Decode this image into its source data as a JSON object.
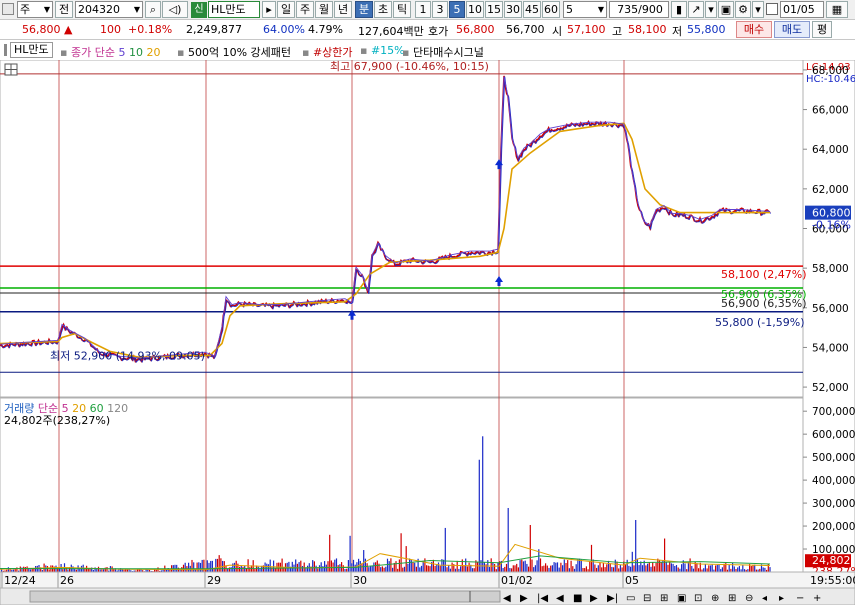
{
  "toolbar": {
    "mode": "주",
    "prev_label": "전",
    "code": "204320",
    "badge": "신",
    "name": "HL만도",
    "periods": [
      "일",
      "주",
      "월",
      "년"
    ],
    "units": [
      "분",
      "초",
      "틱"
    ],
    "intervals": [
      "1",
      "3",
      "5",
      "10",
      "15",
      "30",
      "45",
      "60"
    ],
    "selected_unit": "분",
    "selected_interval": "5",
    "interval_value": "5",
    "count": "735/900",
    "date": "01/05"
  },
  "quote": {
    "price": "56,800",
    "change": "100",
    "change_pct": "+0.18%",
    "volume": "2,249,877",
    "pct1": "64.00%",
    "pct2": "4.79%",
    "amount": "127,604백만",
    "bid_label": "호가",
    "bid": "56,800",
    "ask": "56,700",
    "open_label": "시",
    "open": "57,100",
    "high_label": "고",
    "high": "58,100",
    "low_label": "저",
    "low": "55,800",
    "buy_label": "매수",
    "sell_label": "매도",
    "eval_label": "평"
  },
  "legend": {
    "name": "HL만도",
    "ma_label": "종가 단순",
    "ma_periods": [
      "5",
      "10",
      "20"
    ],
    "pattern_label": "500억 10% 강세패턴",
    "limit_label": "#상한가",
    "pct_label": "#15%",
    "signal_label": "단타매수시그널"
  },
  "annotations": {
    "high": "최고 67,900 (-10.46%, 10:15)",
    "low": "최저 52,900 (14.93%, 09:05)",
    "lc": "LC:14.93",
    "hc": "HC:-10.46",
    "level1": "58,100 (2,47%)",
    "level2": "56,900 (6,35%)",
    "level3": "56,900 (6,35%)",
    "level4": "55,800 (-1,59%)",
    "current_price": "60,800",
    "current_pct": "-0.16%"
  },
  "volume_panel": {
    "label": "거래량",
    "ma_label": "단순",
    "ma_periods": [
      "5",
      "20",
      "60",
      "120"
    ],
    "current": "24,802주(238,27%)",
    "current_value": "24,802",
    "current_pct": "238,27%"
  },
  "bottom": {
    "time": "19:55:00"
  },
  "colors": {
    "up": "#d00000",
    "down": "#1a2ac8",
    "ma5": "#6040d0",
    "ma20": "#e0a000",
    "level_red": "#e00000",
    "level_green": "#00b000",
    "level_navy": "#0a1a80",
    "vline": "#c04040"
  },
  "chart_data": {
    "type": "line",
    "price_axis": {
      "ticks": [
        52000,
        54000,
        56000,
        58000,
        60000,
        62000,
        64000,
        66000,
        68000
      ],
      "labels": [
        "52,000",
        "54,000",
        "56,000",
        "58,000",
        "60,000",
        "62,000",
        "64,000",
        "66,000",
        "68,000"
      ],
      "range": [
        51500,
        68500
      ]
    },
    "volume_axis": {
      "ticks": [
        100000,
        200000,
        300000,
        400000,
        500000,
        600000,
        700000
      ],
      "labels": [
        "100,000",
        "200,000",
        "300,000",
        "400,000",
        "500,000",
        "600,000",
        "700,000"
      ],
      "range": [
        0,
        740000
      ]
    },
    "date_labels": [
      "12/24",
      "26",
      "29",
      "30",
      "01/02",
      "05"
    ],
    "price_series": [
      [
        0,
        54100
      ],
      [
        25,
        54200
      ],
      [
        58,
        54300
      ],
      [
        62,
        55100
      ],
      [
        70,
        54800
      ],
      [
        85,
        54400
      ],
      [
        100,
        53700
      ],
      [
        120,
        53500
      ],
      [
        140,
        53400
      ],
      [
        160,
        53500
      ],
      [
        180,
        53600
      ],
      [
        205,
        53700
      ],
      [
        215,
        53500
      ],
      [
        222,
        55000
      ],
      [
        226,
        56500
      ],
      [
        232,
        56100
      ],
      [
        240,
        56200
      ],
      [
        260,
        56100
      ],
      [
        280,
        56100
      ],
      [
        300,
        56200
      ],
      [
        320,
        56300
      ],
      [
        345,
        56400
      ],
      [
        352,
        56200
      ],
      [
        356,
        58000
      ],
      [
        362,
        57600
      ],
      [
        368,
        56800
      ],
      [
        372,
        58600
      ],
      [
        378,
        59200
      ],
      [
        385,
        58600
      ],
      [
        395,
        58200
      ],
      [
        410,
        58400
      ],
      [
        430,
        58300
      ],
      [
        450,
        58600
      ],
      [
        470,
        58800
      ],
      [
        490,
        58800
      ],
      [
        498,
        58900
      ],
      [
        501,
        64000
      ],
      [
        504,
        67600
      ],
      [
        508,
        66600
      ],
      [
        512,
        64500
      ],
      [
        518,
        63500
      ],
      [
        524,
        64000
      ],
      [
        532,
        64300
      ],
      [
        540,
        64700
      ],
      [
        550,
        65000
      ],
      [
        570,
        65200
      ],
      [
        590,
        65300
      ],
      [
        610,
        65300
      ],
      [
        624,
        65200
      ],
      [
        628,
        64200
      ],
      [
        632,
        62800
      ],
      [
        638,
        61200
      ],
      [
        644,
        60300
      ],
      [
        650,
        60100
      ],
      [
        656,
        60900
      ],
      [
        664,
        61100
      ],
      [
        672,
        60700
      ],
      [
        680,
        60700
      ],
      [
        690,
        60600
      ],
      [
        700,
        60400
      ],
      [
        712,
        60600
      ],
      [
        720,
        60900
      ],
      [
        740,
        60900
      ],
      [
        770,
        60800
      ]
    ],
    "ma20_series": [
      [
        0,
        54200
      ],
      [
        58,
        54300
      ],
      [
        62,
        54500
      ],
      [
        75,
        54700
      ],
      [
        90,
        54300
      ],
      [
        110,
        53800
      ],
      [
        140,
        53500
      ],
      [
        180,
        53600
      ],
      [
        210,
        53600
      ],
      [
        222,
        54200
      ],
      [
        230,
        55600
      ],
      [
        240,
        56100
      ],
      [
        280,
        56200
      ],
      [
        345,
        56300
      ],
      [
        356,
        56700
      ],
      [
        370,
        57700
      ],
      [
        390,
        58300
      ],
      [
        430,
        58400
      ],
      [
        480,
        58600
      ],
      [
        498,
        58800
      ],
      [
        504,
        60000
      ],
      [
        512,
        63000
      ],
      [
        530,
        63800
      ],
      [
        560,
        64900
      ],
      [
        600,
        65200
      ],
      [
        624,
        65300
      ],
      [
        632,
        64500
      ],
      [
        645,
        62000
      ],
      [
        660,
        61200
      ],
      [
        680,
        60800
      ],
      [
        720,
        60800
      ],
      [
        770,
        60800
      ]
    ],
    "volume_series": [
      [
        0,
        12000
      ],
      [
        60,
        30000
      ],
      [
        150,
        8000
      ],
      [
        225,
        70000
      ],
      [
        356,
        260000
      ],
      [
        372,
        130000
      ],
      [
        501,
        650000
      ],
      [
        512,
        250000
      ],
      [
        630,
        210000
      ],
      [
        700,
        30000
      ],
      [
        770,
        24802
      ]
    ],
    "levels": [
      58100,
      57000,
      56900,
      55800
    ],
    "extremes": {
      "high": 67900,
      "low": 52900
    },
    "current": 60800
  }
}
